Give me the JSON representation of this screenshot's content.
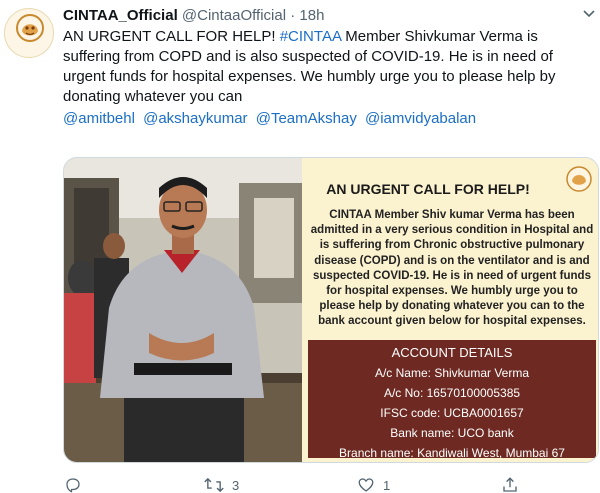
{
  "tweet": {
    "display_name": "CINTAA_Official",
    "handle": "@CintaaOfficial",
    "separator": "·",
    "time": "18h",
    "text_intro": "AN URGENT CALL FOR HELP! ",
    "hashtag": "#CINTAA",
    "text_rest": " Member Shivkumar Verma is suffering from COPD and is also suspected of COVID-19. He is in need of urgent funds for hospital expenses. We humbly urge you to please help by donating whatever you can",
    "mentions": [
      "@amitbehl",
      "@akshaykumar",
      "@TeamAkshay",
      "@iamvidyabalan"
    ]
  },
  "avatar_logo_text": "CINTAA",
  "poster": {
    "title": "AN URGENT CALL FOR HELP!",
    "logo_text": "CINTAA",
    "body": "CINTAA Member Shiv kumar Verma has been admitted in a very serious condition in Hospital and is suffering from Chronic obstructive pulmonary disease (COPD) and is on the ventilator and is and suspected COVID-19. He is in need of urgent funds for hospital expenses. We humbly urge you to please help by donating whatever you can to the bank account given below for hospital expenses.",
    "account_title": "ACCOUNT DETAILS",
    "account_lines": [
      "A/c Name: Shivkumar Verma",
      "A/c No: 16570100005385",
      "IFSC code: UCBA0001657",
      "Bank name: UCO bank",
      "Branch name: Kandiwali West, Mumbai 67"
    ]
  },
  "actions": {
    "reply_count": "",
    "retweet_count": "3",
    "like_count": "1",
    "share_count": ""
  },
  "colors": {
    "link": "#1b6fc5",
    "poster_bg": "#fbf2cf",
    "account_bg": "#6e2a22",
    "muted": "#536471"
  }
}
